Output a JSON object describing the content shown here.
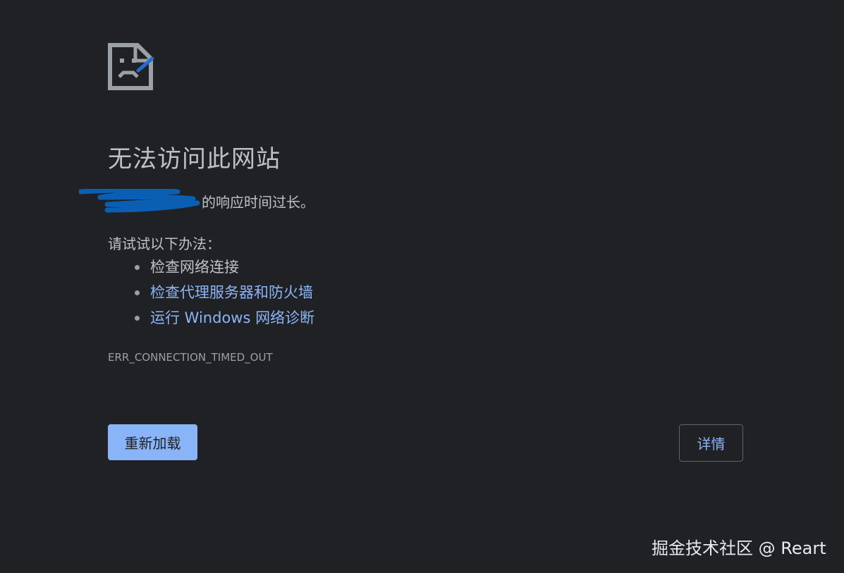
{
  "error": {
    "title": "无法访问此网站",
    "summary_suffix": "的响应时间过长。",
    "suggestions_heading": "请试试以下办法：",
    "suggestions": [
      {
        "label": "检查网络连接",
        "link": false
      },
      {
        "label": "检查代理服务器和防火墙",
        "link": true
      },
      {
        "label": "运行 Windows 网络诊断",
        "link": true
      }
    ],
    "code": "ERR_CONNECTION_TIMED_OUT"
  },
  "buttons": {
    "reload_label": "重新加载",
    "details_label": "详情"
  },
  "watermark": {
    "text": "掘金技术社区 @ Reart"
  },
  "icons": {
    "error_page": "sad-page-icon"
  },
  "colors": {
    "background": "#202124",
    "primary_text": "#bdc1c6",
    "secondary_text": "#9aa0a6",
    "link": "#8ab4f8",
    "redaction": "#0a5fb4"
  }
}
